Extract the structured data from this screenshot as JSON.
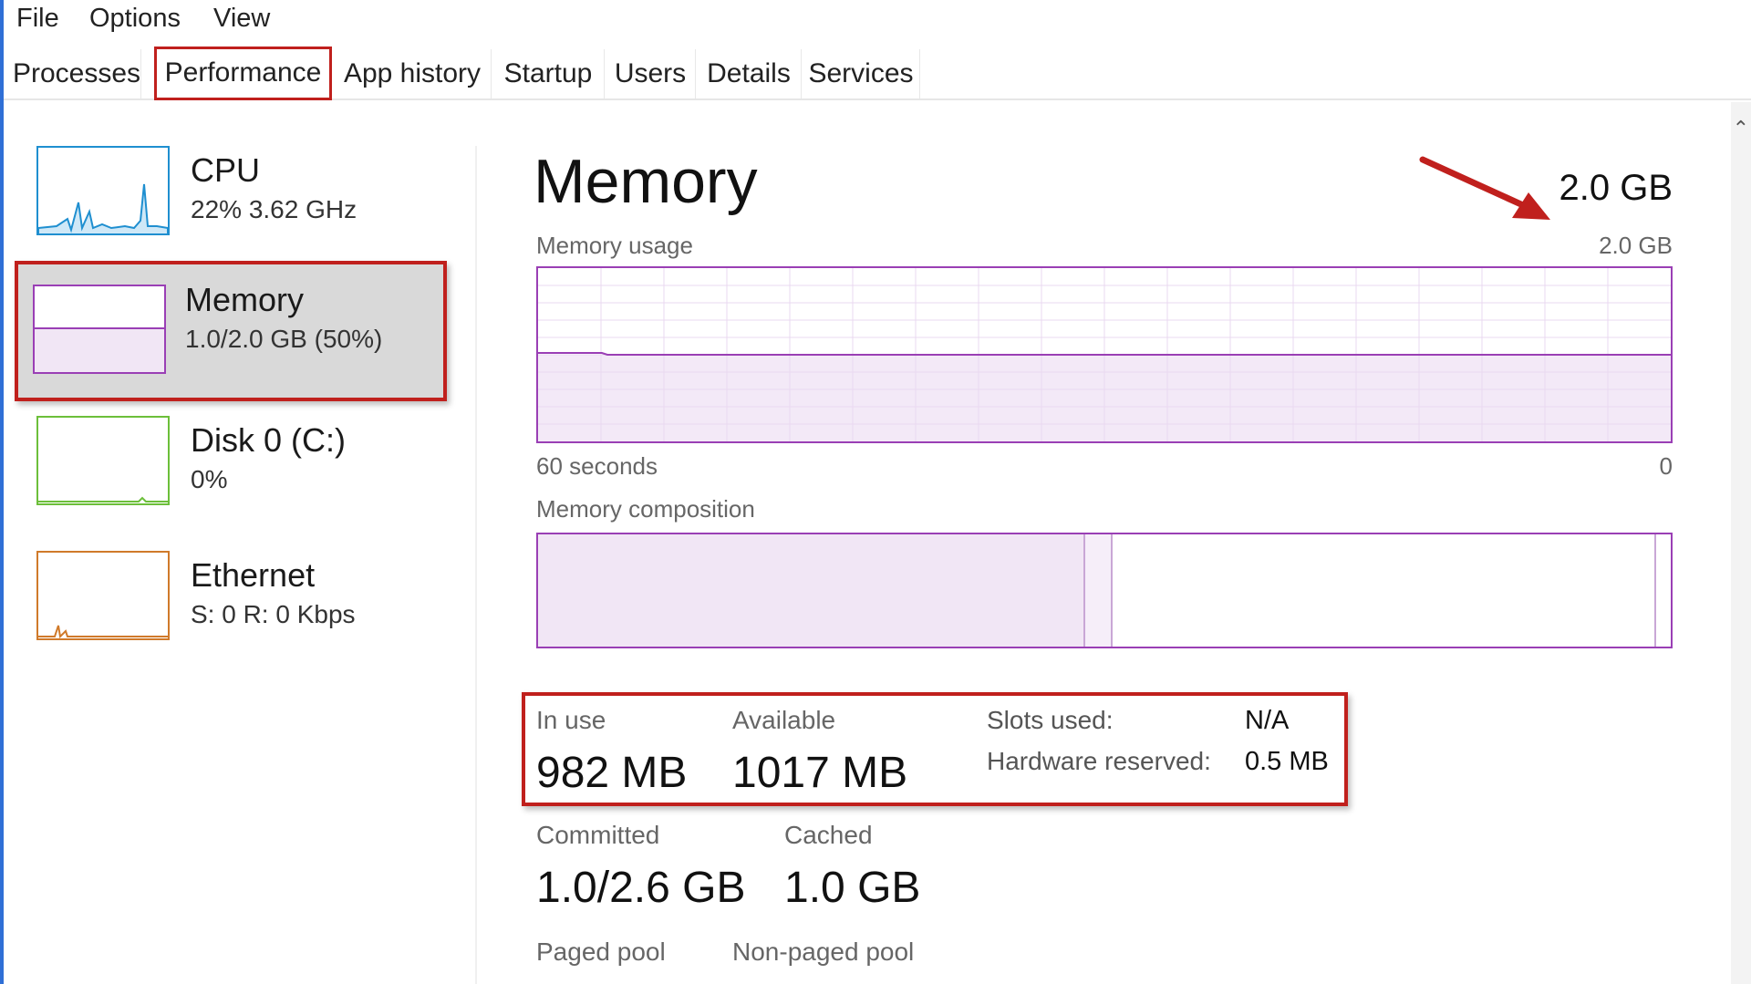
{
  "menu": {
    "file": "File",
    "options": "Options",
    "view": "View"
  },
  "tabs": [
    "Processes",
    "Performance",
    "App history",
    "Startup",
    "Users",
    "Details",
    "Services"
  ],
  "sidebar": {
    "cpu": {
      "name": "CPU",
      "sub": "22%  3.62 GHz"
    },
    "memory": {
      "name": "Memory",
      "sub": "1.0/2.0 GB (50%)"
    },
    "disk": {
      "name": "Disk 0 (C:)",
      "sub": "0%"
    },
    "ethernet": {
      "name": "Ethernet",
      "sub": "S: 0 R: 0 Kbps"
    }
  },
  "main": {
    "title": "Memory",
    "total": "2.0 GB",
    "usage_label": "Memory usage",
    "usage_max": "2.0 GB",
    "time_label": "60 seconds",
    "time_end": "0",
    "composition_label": "Memory composition",
    "usage_fraction": 0.5
  },
  "stats": {
    "in_use_label": "In use",
    "in_use": "982 MB",
    "available_label": "Available",
    "available": "1017 MB",
    "slots_label": "Slots used:",
    "slots": "N/A",
    "hw_label": "Hardware reserved:",
    "hw": "0.5 MB",
    "committed_label": "Committed",
    "committed": "1.0/2.6 GB",
    "cached_label": "Cached",
    "cached": "1.0 GB",
    "paged_label": "Paged pool",
    "nonpaged_label": "Non-paged pool"
  },
  "colors": {
    "accent_memory": "#9a3fb5",
    "cpu": "#1f8fd0",
    "disk": "#6cbf3a",
    "ethernet": "#d07a2a",
    "highlight": "#c0201d"
  }
}
